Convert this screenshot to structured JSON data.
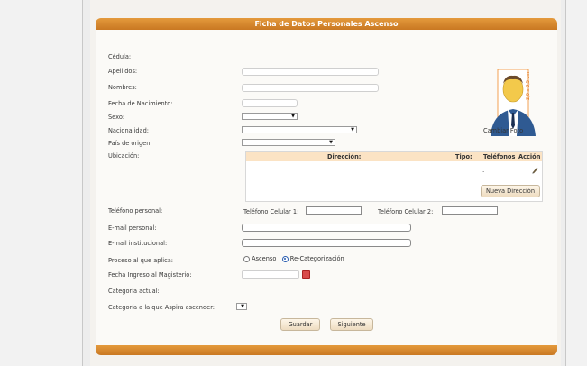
{
  "form": {
    "title": "Ficha de Datos Personales Ascenso",
    "labels": {
      "cedula": "Cédula:",
      "apellidos": "Apellidos:",
      "nombres": "Nombres:",
      "fecha_nacimiento": "Fecha de Nacimiento:",
      "sexo": "Sexo:",
      "nacionalidad": "Nacionalidad:",
      "pais_origen": "País de origen:",
      "ubicacion": "Ubicación:",
      "telefono_personal": "Teléfono personal:",
      "email_personal": "E-mail personal:",
      "email_institucional": "E-mail institucional:",
      "proceso": "Proceso al que aplica:",
      "fecha_ingreso": "Fecha Ingreso al Magisterio:",
      "categoria_actual": "Categoría actual:",
      "categoria_aspira": "Categoría a la que Aspira ascender:"
    },
    "photo": {
      "badge": "2,0 x 3,5 cm",
      "change_label": "Cambiar Foto"
    },
    "address_table": {
      "columns": [
        "Dirección:",
        "Tipo:",
        "Teléfonos",
        "Acción"
      ],
      "row_marker": ".",
      "new_button": "Nueva Dirección"
    },
    "phones": {
      "celular1_label": "Teléfono Celular 1:",
      "celular2_label": "Teléfono Celular 2:"
    },
    "proceso_options": {
      "ascenso": "Ascenso",
      "recategorizacion": "Re-Categorización",
      "selected": "Re-Categorización"
    },
    "buttons": {
      "guardar": "Guardar",
      "siguiente": "Siguiente"
    }
  },
  "colors": {
    "header_orange": "#d9892f",
    "table_header": "#fbe3c4",
    "radio_selected": "#2a5db0"
  }
}
